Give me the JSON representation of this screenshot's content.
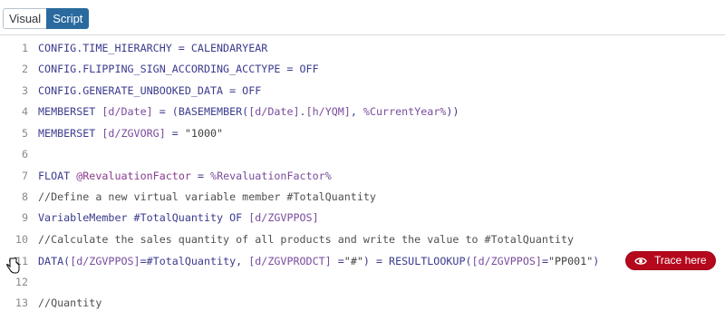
{
  "tabs": [
    {
      "label": "Visual",
      "active": false
    },
    {
      "label": "Script",
      "active": true
    }
  ],
  "editor": {
    "lines": [
      {
        "num": "1",
        "segments": [
          {
            "t": "CONFIG.TIME_HIERARCHY = CALENDARYEAR",
            "c": "kw"
          }
        ]
      },
      {
        "num": "2",
        "segments": [
          {
            "t": "CONFIG.FLIPPING_SIGN_ACCORDING_ACCTYPE = OFF",
            "c": "kw"
          }
        ]
      },
      {
        "num": "3",
        "segments": [
          {
            "t": "CONFIG.GENERATE_UNBOOKED_DATA = OFF",
            "c": "kw"
          }
        ]
      },
      {
        "num": "4",
        "segments": [
          {
            "t": "MEMBERSET ",
            "c": "kw"
          },
          {
            "t": "[d/Date]",
            "c": "dim"
          },
          {
            "t": " = (BASEMEMBER(",
            "c": "kw"
          },
          {
            "t": "[d/Date]",
            "c": "dim"
          },
          {
            "t": ".",
            "c": "kw"
          },
          {
            "t": "[h/YQM]",
            "c": "dim"
          },
          {
            "t": ", ",
            "c": "kw"
          },
          {
            "t": "%CurrentYear%",
            "c": "par"
          },
          {
            "t": "))",
            "c": "kw"
          }
        ]
      },
      {
        "num": "5",
        "segments": [
          {
            "t": "MEMBERSET ",
            "c": "kw"
          },
          {
            "t": "[d/ZGVORG]",
            "c": "dim"
          },
          {
            "t": " = ",
            "c": "kw"
          },
          {
            "t": "\"1000\"",
            "c": "str"
          }
        ]
      },
      {
        "num": "6",
        "segments": []
      },
      {
        "num": "7",
        "segments": [
          {
            "t": "FLOAT ",
            "c": "kw"
          },
          {
            "t": "@RevaluationFactor",
            "c": "var"
          },
          {
            "t": " = ",
            "c": "kw"
          },
          {
            "t": "%RevaluationFactor%",
            "c": "par"
          }
        ]
      },
      {
        "num": "8",
        "segments": [
          {
            "t": "//Define a new virtual variable member #TotalQuantity",
            "c": "cmt"
          }
        ]
      },
      {
        "num": "9",
        "segments": [
          {
            "t": "VariableMember #TotalQuantity OF ",
            "c": "kw"
          },
          {
            "t": "[d/ZGVPPOS]",
            "c": "dim"
          }
        ]
      },
      {
        "num": "10",
        "segments": []
      },
      {
        "num": "10",
        "segments": [
          {
            "t": "//Calculate the sales quantity of all products and write the value to #TotalQuantity",
            "c": "cmt"
          }
        ]
      },
      {
        "num": "11",
        "segments": [
          {
            "t": "DATA(",
            "c": "kw"
          },
          {
            "t": "[d/ZGVPPOS]",
            "c": "dim"
          },
          {
            "t": "=#TotalQuantity, ",
            "c": "kw"
          },
          {
            "t": "[d/ZGVPRODCT]",
            "c": "dim"
          },
          {
            "t": " =",
            "c": "kw"
          },
          {
            "t": "\"#\"",
            "c": "str"
          },
          {
            "t": ") = RESULTLOOKUP(",
            "c": "kw"
          },
          {
            "t": "[d/ZGVPPOS]",
            "c": "dim"
          },
          {
            "t": "=",
            "c": "kw"
          },
          {
            "t": "\"PP001\"",
            "c": "str"
          },
          {
            "t": ")",
            "c": "kw"
          }
        ]
      },
      {
        "num": "12",
        "segments": []
      },
      {
        "num": "13",
        "segments": [
          {
            "t": "//Quantity",
            "c": "cmt"
          }
        ]
      }
    ],
    "trace_button": {
      "label": "Trace here",
      "icon": "eye-icon"
    }
  },
  "colors": {
    "tab_active_bg": "#2a6a9e",
    "trace_bg": "#b5081c",
    "keyword": "#3b3b8f",
    "dimension": "#7a4c9c",
    "comment": "#4f4f4f"
  }
}
